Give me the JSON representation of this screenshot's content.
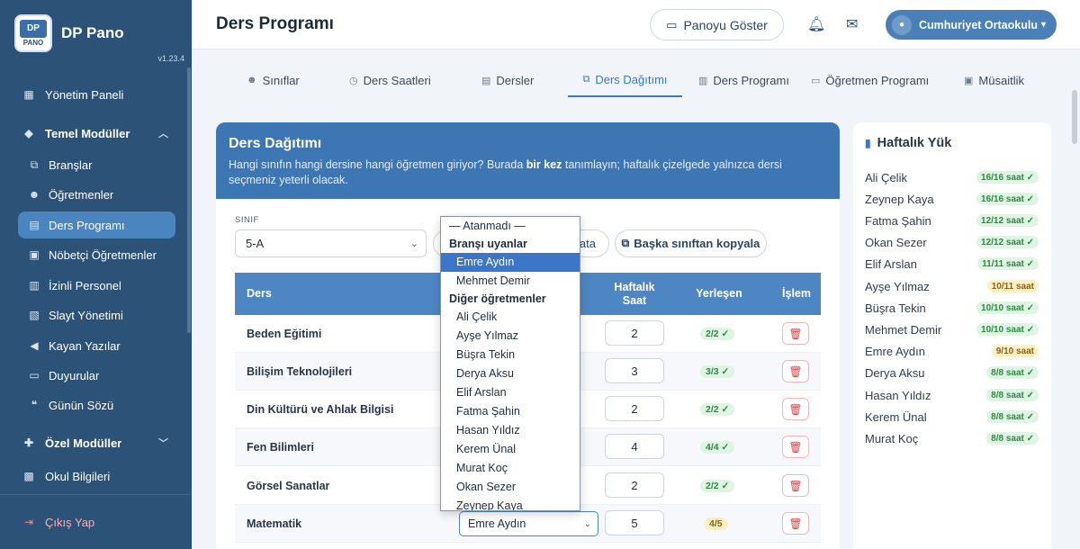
{
  "app": {
    "name": "DP Pano",
    "version": "v1.23.4",
    "logo_top": "DP",
    "logo_bottom": "PANO"
  },
  "sidebar": {
    "items": [
      {
        "label": "Yönetim Paneli",
        "icon": "dashboard-icon"
      },
      {
        "label": "Temel Modüller",
        "icon": "layers-icon"
      },
      {
        "label": "Branşlar",
        "icon": "sitemap-icon"
      },
      {
        "label": "Öğretmenler",
        "icon": "users-icon"
      },
      {
        "label": "Ders Programı",
        "icon": "book-icon"
      },
      {
        "label": "Nöbetçi Öğretmenler",
        "icon": "clipboard-icon"
      },
      {
        "label": "İzinli Personel",
        "icon": "calendar-icon"
      },
      {
        "label": "Slayt Yönetimi",
        "icon": "image-icon"
      },
      {
        "label": "Kayan Yazılar",
        "icon": "megaphone-icon"
      },
      {
        "label": "Duyurular",
        "icon": "message-icon"
      },
      {
        "label": "Günün Sözü",
        "icon": "quote-icon"
      },
      {
        "label": "Özel Modüller",
        "icon": "puzzle-icon"
      },
      {
        "label": "Okul Bilgileri",
        "icon": "building-icon"
      }
    ],
    "logout": "Çıkış Yap"
  },
  "header": {
    "title": "Ders Programı",
    "show_board": "Panoyu Göster",
    "user": "Cumhuriyet Ortaokulu"
  },
  "tabs": [
    "Sınıflar",
    "Ders Saatleri",
    "Dersler",
    "Ders Dağıtımı",
    "Ders Programı",
    "Öğretmen Programı",
    "Müsaitlik"
  ],
  "distribution": {
    "title": "Ders Dağıtımı",
    "desc_before": "Hangi sınıfın hangi dersine hangi öğretmen giriyor? Burada ",
    "desc_bold": "bir kez",
    "desc_after": " tanımlayın; haftalık çizelgede yalnızca dersi seçmeniz yeterli olacak.",
    "class_label": "SINIF",
    "class_value": "5-A",
    "hidden_button": "ata",
    "copy_button": "Başka sınıftan kopyala",
    "columns": {
      "course": "Ders",
      "weekly1": "Haftalık",
      "weekly2": "Saat",
      "placed": "Yerleşen",
      "action": "İşlem"
    },
    "rows": [
      {
        "course": "Beden Eğitimi",
        "hours": "2",
        "placed": "2/2 ✓",
        "status": "ok",
        "teacher": ""
      },
      {
        "course": "Bilişim Teknolojileri",
        "hours": "3",
        "placed": "3/3 ✓",
        "status": "ok",
        "teacher": ""
      },
      {
        "course": "Din Kültürü ve Ahlak Bilgisi",
        "hours": "2",
        "placed": "2/2 ✓",
        "status": "ok",
        "teacher": ""
      },
      {
        "course": "Fen Bilimleri",
        "hours": "4",
        "placed": "4/4 ✓",
        "status": "ok",
        "teacher": ""
      },
      {
        "course": "Görsel Sanatlar",
        "hours": "2",
        "placed": "2/2 ✓",
        "status": "ok",
        "teacher": ""
      },
      {
        "course": "Matematik",
        "hours": "5",
        "placed": "4/5",
        "status": "warn",
        "teacher": "Emre Aydın"
      }
    ]
  },
  "dropdown": {
    "placeholder": "— Atanmadı —",
    "group1": "Branşı uyanlar",
    "group1_items": [
      "Emre Aydın",
      "Mehmet Demir"
    ],
    "selected": "Emre Aydın",
    "group2": "Diğer öğretmenler",
    "group2_items": [
      "Ali Çelik",
      "Ayşe Yılmaz",
      "Büşra Tekin",
      "Derya Aksu",
      "Elif Arslan",
      "Fatma Şahin",
      "Hasan Yıldız",
      "Kerem Ünal",
      "Murat Koç",
      "Okan Sezer",
      "Zeynep Kaya"
    ]
  },
  "weekly_load": {
    "title": "Haftalık Yük",
    "rows": [
      {
        "name": "Ali Çelik",
        "load": "16/16 saat ✓",
        "status": "ok"
      },
      {
        "name": "Zeynep Kaya",
        "load": "16/16 saat ✓",
        "status": "ok"
      },
      {
        "name": "Fatma Şahin",
        "load": "12/12 saat ✓",
        "status": "ok"
      },
      {
        "name": "Okan Sezer",
        "load": "12/12 saat ✓",
        "status": "ok"
      },
      {
        "name": "Elif Arslan",
        "load": "11/11 saat ✓",
        "status": "ok"
      },
      {
        "name": "Ayşe Yılmaz",
        "load": "10/11 saat",
        "status": "warn"
      },
      {
        "name": "Büşra Tekin",
        "load": "10/10 saat ✓",
        "status": "ok"
      },
      {
        "name": "Mehmet Demir",
        "load": "10/10 saat ✓",
        "status": "ok"
      },
      {
        "name": "Emre Aydın",
        "load": "9/10 saat",
        "status": "warn"
      },
      {
        "name": "Derya Aksu",
        "load": "8/8 saat ✓",
        "status": "ok"
      },
      {
        "name": "Hasan Yıldız",
        "load": "8/8 saat ✓",
        "status": "ok"
      },
      {
        "name": "Kerem Ünal",
        "load": "8/8 saat ✓",
        "status": "ok"
      },
      {
        "name": "Murat Koç",
        "load": "8/8 saat ✓",
        "status": "ok"
      }
    ]
  },
  "colors": {
    "sidebar": "#2c5278",
    "accent": "#3e76b4",
    "ok": "#2c8a45",
    "warn": "#8a6511",
    "danger": "#d64545"
  }
}
